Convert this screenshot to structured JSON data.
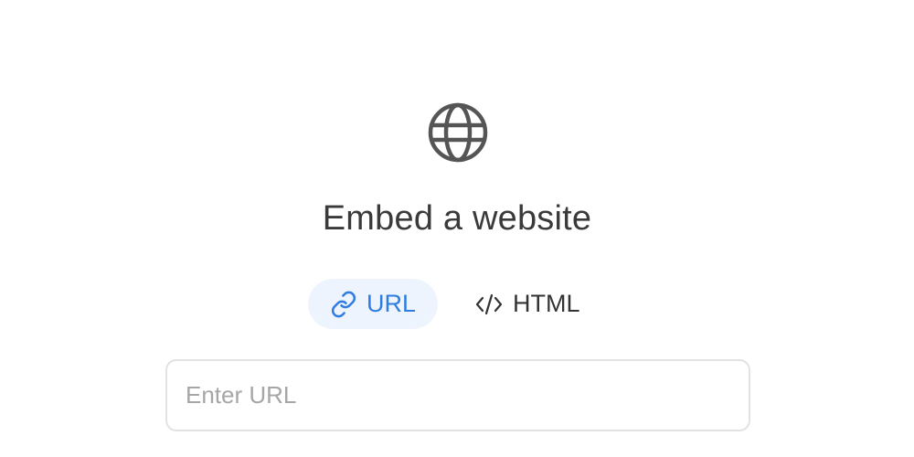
{
  "dialog": {
    "icon": "globe-icon",
    "title": "Embed a website"
  },
  "tabs": [
    {
      "label": "URL",
      "icon": "link-icon",
      "active": true
    },
    {
      "label": "HTML",
      "icon": "code-icon",
      "active": false
    }
  ],
  "input": {
    "placeholder": "Enter URL",
    "value": ""
  },
  "colors": {
    "accent": "#2f7de1",
    "active_tab_bg": "#eef4fd",
    "text": "#3a3a3a",
    "icon": "#555555",
    "input_border": "#e2e2e2",
    "placeholder": "#a6a6a6"
  }
}
